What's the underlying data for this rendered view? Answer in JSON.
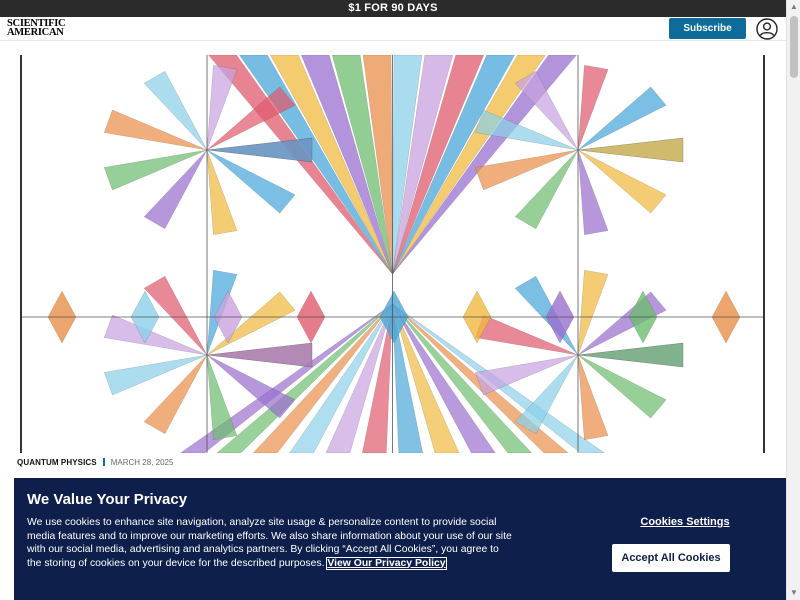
{
  "promo": {
    "text": "$1 FOR 90 DAYS"
  },
  "header": {
    "logo_line1": "SCIENTIFIC",
    "logo_line2": "AMERICAN",
    "subscribe_label": "Subscribe",
    "account_icon": "user-account-icon"
  },
  "hero": {
    "description_icon": "quantum-fractal-illustration",
    "palette": [
      "#e05a6e",
      "#4aa6d9",
      "#f0b93e",
      "#9a6fcf",
      "#6dbd6f",
      "#e98f4a",
      "#8cd0e8",
      "#c9a2e0"
    ]
  },
  "article": {
    "kicker": "QUANTUM PHYSICS",
    "date": "MARCH 28, 2025"
  },
  "cookie": {
    "title": "We Value Your Privacy",
    "body": "We use cookies to enhance site navigation, analyze site usage & personalize content to provide social media features and to improve our marketing efforts. We also share information about your use of our site with our social media, advertising and analytics partners. By clicking “Accept All Cookies”, you agree to the storing of cookies on your device for the described purposes.",
    "policy_link": "View Our Privacy Policy",
    "settings_label": "Cookies Settings",
    "accept_label": "Accept All Cookies",
    "background": "#0d1f4a"
  },
  "colors": {
    "accent": "#0e6b9a",
    "promo_bar": "#2b2b2b"
  }
}
